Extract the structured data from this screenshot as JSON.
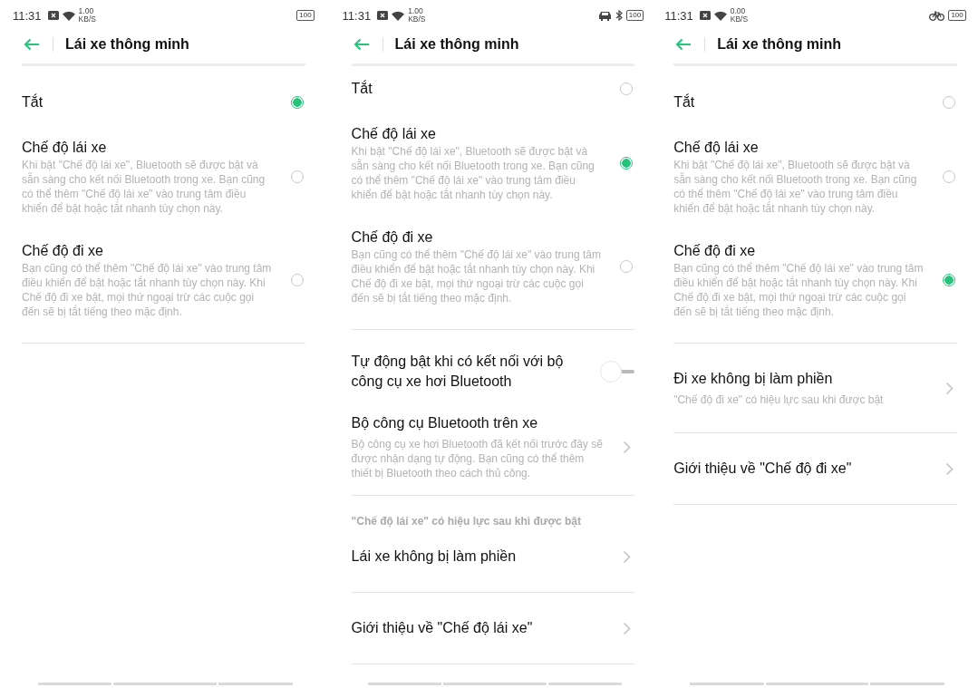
{
  "screens": [
    {
      "status_bar": {
        "time": "11:31",
        "speed": "1.00",
        "speed_unit": "KB/S",
        "battery": "100"
      },
      "title": "Lái xe thông minh",
      "sections": [
        {
          "items": [
            {
              "kind": "radio",
              "title": "Tắt",
              "selected": true
            },
            {
              "kind": "radio",
              "title": "Chế độ lái xe",
              "desc": "Khi bật \"Chế độ lái xe\", Bluetooth sẽ được bật và sẵn sàng cho kết nối Bluetooth trong xe. Bạn cũng có thể thêm \"Chế độ lái xe\" vào trung tâm điều khiển để bật hoặc tắt nhanh tùy chọn này.",
              "selected": false
            },
            {
              "kind": "radio",
              "title": "Chế độ đi xe",
              "desc": "Bạn cũng có thể thêm \"Chế độ lái xe\" vào trung tâm điều khiển để bật hoặc tắt nhanh tùy chọn này. Khi Chế độ đi xe bật, mọi thứ ngoại trừ các cuộc gọi đến sẽ bị tắt tiếng theo mặc định.",
              "selected": false
            }
          ]
        }
      ]
    },
    {
      "status_bar": {
        "time": "11:31",
        "speed": "1.00",
        "speed_unit": "KB/S",
        "battery": "100",
        "indicators": [
          {
            "kind": "car"
          },
          {
            "kind": "bluetooth"
          }
        ]
      },
      "title": "Lái xe thông minh",
      "sections": [
        {
          "items": [
            {
              "kind": "radio",
              "title": "Tắt",
              "selected": false
            },
            {
              "kind": "radio",
              "title": "Chế độ lái xe",
              "desc": "Khi bật \"Chế độ lái xe\", Bluetooth sẽ được bật và sẵn sàng cho kết nối Bluetooth trong xe. Bạn cũng có thể thêm \"Chế độ lái xe\" vào trung tâm điều khiển để bật hoặc tắt nhanh tùy chọn này.",
              "selected": true
            },
            {
              "kind": "radio",
              "title": "Chế độ đi xe",
              "desc": "Bạn cũng có thể thêm \"Chế độ lái xe\" vào trung tâm điều khiển để bật hoặc tắt nhanh tùy chọn này. Khi Chế độ đi xe bật, mọi thứ ngoại trừ các cuộc gọi đến sẽ bị tắt tiếng theo mặc định.",
              "selected": false
            }
          ]
        },
        {
          "items": [
            {
              "kind": "toggle",
              "title": "Tự động bật khi có kết nối với bộ công cụ xe hơi Bluetooth",
              "on": false
            },
            {
              "kind": "link",
              "title": "Bộ công cụ Bluetooth trên xe",
              "desc": "Bộ công cụ xe hơi Bluetooth đã kết nối trước đây sẽ được nhận dạng tự động. Bạn cũng có thể thêm thiết bị Bluetooth theo cách thủ công."
            }
          ]
        },
        {
          "header": "\"Chế độ lái xe\" có hiệu lực sau khi được bật",
          "items": [
            {
              "kind": "link",
              "title": "Lái xe không bị làm phiền"
            }
          ]
        },
        {
          "items": [
            {
              "kind": "link",
              "title": "Giới thiệu về \"Chế độ lái xe\""
            }
          ]
        }
      ]
    },
    {
      "status_bar": {
        "time": "11:31",
        "speed": "0.00",
        "speed_unit": "KB/S",
        "battery": "100",
        "indicators": [
          {
            "kind": "bicycle"
          }
        ]
      },
      "title": "Lái xe thông minh",
      "sections": [
        {
          "items": [
            {
              "kind": "radio",
              "title": "Tắt",
              "selected": false
            },
            {
              "kind": "radio",
              "title": "Chế độ lái xe",
              "desc": "Khi bật \"Chế độ lái xe\", Bluetooth sẽ được bật và sẵn sàng cho kết nối Bluetooth trong xe. Bạn cũng có thể thêm \"Chế độ lái xe\" vào trung tâm điều khiển để bật hoặc tắt nhanh tùy chọn này.",
              "selected": false
            },
            {
              "kind": "radio",
              "title": "Chế độ đi xe",
              "desc": "Bạn cũng có thể thêm \"Chế độ lái xe\" vào trung tâm điều khiển để bật hoặc tắt nhanh tùy chọn này. Khi Chế độ đi xe bật, mọi thứ ngoại trừ các cuộc gọi đến sẽ bị tắt tiếng theo mặc định.",
              "selected": true
            }
          ]
        },
        {
          "items": [
            {
              "kind": "link",
              "title": "Đi xe không bị làm phiền",
              "desc": "\"Chế độ đi xe\" có hiệu lực sau khi được bật"
            }
          ]
        },
        {
          "items": [
            {
              "kind": "link",
              "title": "Giới thiệu về \"Chế độ đi xe\""
            }
          ]
        }
      ]
    }
  ]
}
